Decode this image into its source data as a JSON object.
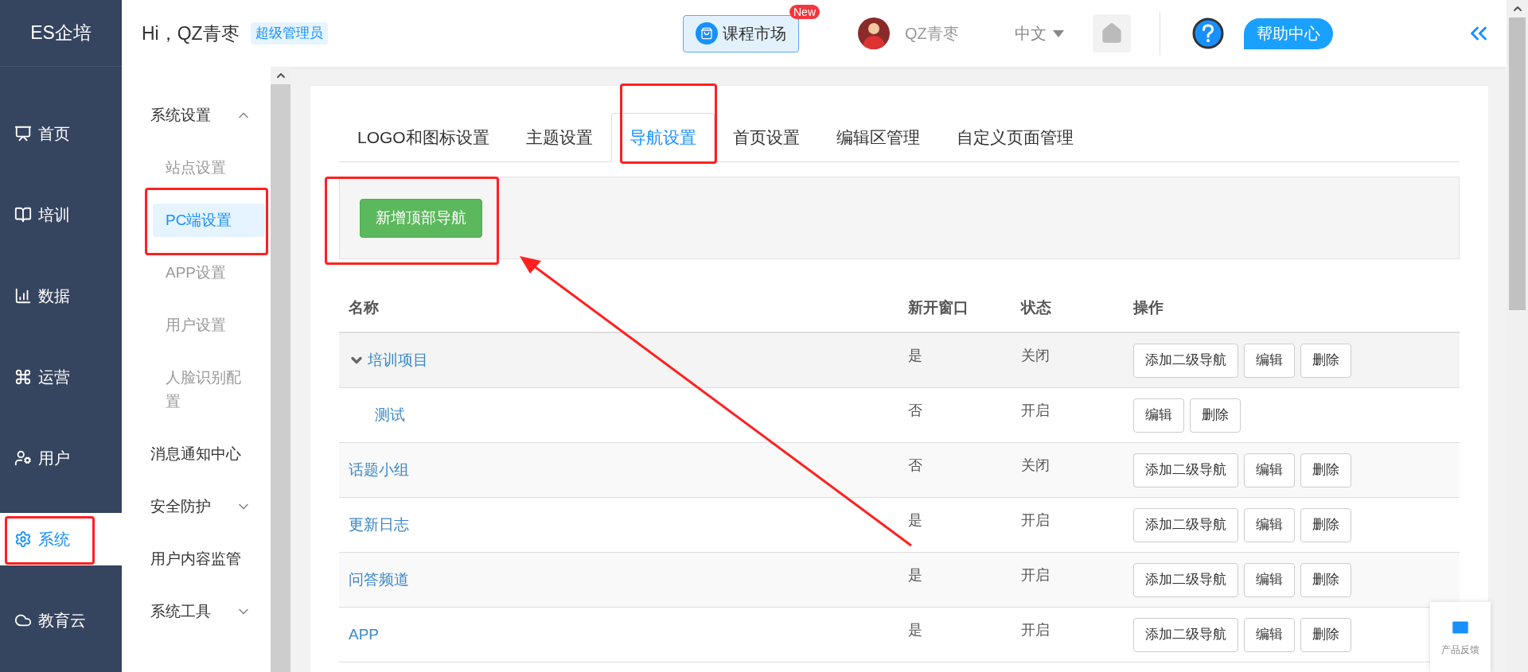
{
  "header": {
    "logo": "ES企培",
    "greeting": "Hi，QZ青枣",
    "role_badge": "超级管理员",
    "course_market": {
      "label": "课程市场",
      "badge": "New"
    },
    "user_name": "QZ青枣",
    "language": "中文",
    "help": "帮助中心"
  },
  "main_nav": [
    {
      "label": "首页",
      "selected": false
    },
    {
      "label": "培训",
      "selected": false
    },
    {
      "label": "数据",
      "selected": false
    },
    {
      "label": "运营",
      "selected": false
    },
    {
      "label": "用户",
      "selected": false
    },
    {
      "label": "系统",
      "selected": true
    },
    {
      "label": "教育云",
      "selected": false
    }
  ],
  "sub_nav": [
    {
      "label": "系统设置",
      "expanded": true,
      "children": [
        {
          "label": "站点设置",
          "selected": false
        },
        {
          "label": "PC端设置",
          "selected": true
        },
        {
          "label": "APP设置",
          "selected": false
        },
        {
          "label": "用户设置",
          "selected": false
        },
        {
          "label": "人脸识别配置",
          "selected": false
        }
      ]
    },
    {
      "label": "消息通知中心"
    },
    {
      "label": "安全防护",
      "expanded": false
    },
    {
      "label": "用户内容监管"
    },
    {
      "label": "系统工具",
      "expanded": false
    }
  ],
  "tabs": [
    {
      "label": "LOGO和图标设置",
      "selected": false
    },
    {
      "label": "主题设置",
      "selected": false
    },
    {
      "label": "导航设置",
      "selected": true
    },
    {
      "label": "首页设置",
      "selected": false
    },
    {
      "label": "编辑区管理",
      "selected": false
    },
    {
      "label": "自定义页面管理",
      "selected": false
    }
  ],
  "toolbar": {
    "add_button": "新增顶部导航"
  },
  "table": {
    "columns": [
      "名称",
      "新开窗口",
      "状态",
      "操作"
    ],
    "rows": [
      {
        "name": "培训项目",
        "new_window": "是",
        "status": "关闭",
        "actions": [
          "添加二级导航",
          "编辑",
          "删除"
        ],
        "expanded": true,
        "children": [
          {
            "name": "测试",
            "new_window": "否",
            "status": "开启",
            "actions": [
              "编辑",
              "删除"
            ]
          }
        ]
      },
      {
        "name": "话题小组",
        "new_window": "否",
        "status": "关闭",
        "actions": [
          "添加二级导航",
          "编辑",
          "删除"
        ]
      },
      {
        "name": "更新日志",
        "new_window": "是",
        "status": "开启",
        "actions": [
          "添加二级导航",
          "编辑",
          "删除"
        ]
      },
      {
        "name": "问答频道",
        "new_window": "是",
        "status": "开启",
        "actions": [
          "添加二级导航",
          "编辑",
          "删除"
        ]
      },
      {
        "name": "APP",
        "new_window": "是",
        "status": "开启",
        "actions": [
          "添加二级导航",
          "编辑",
          "删除"
        ]
      }
    ]
  },
  "feedback": "产品反馈"
}
